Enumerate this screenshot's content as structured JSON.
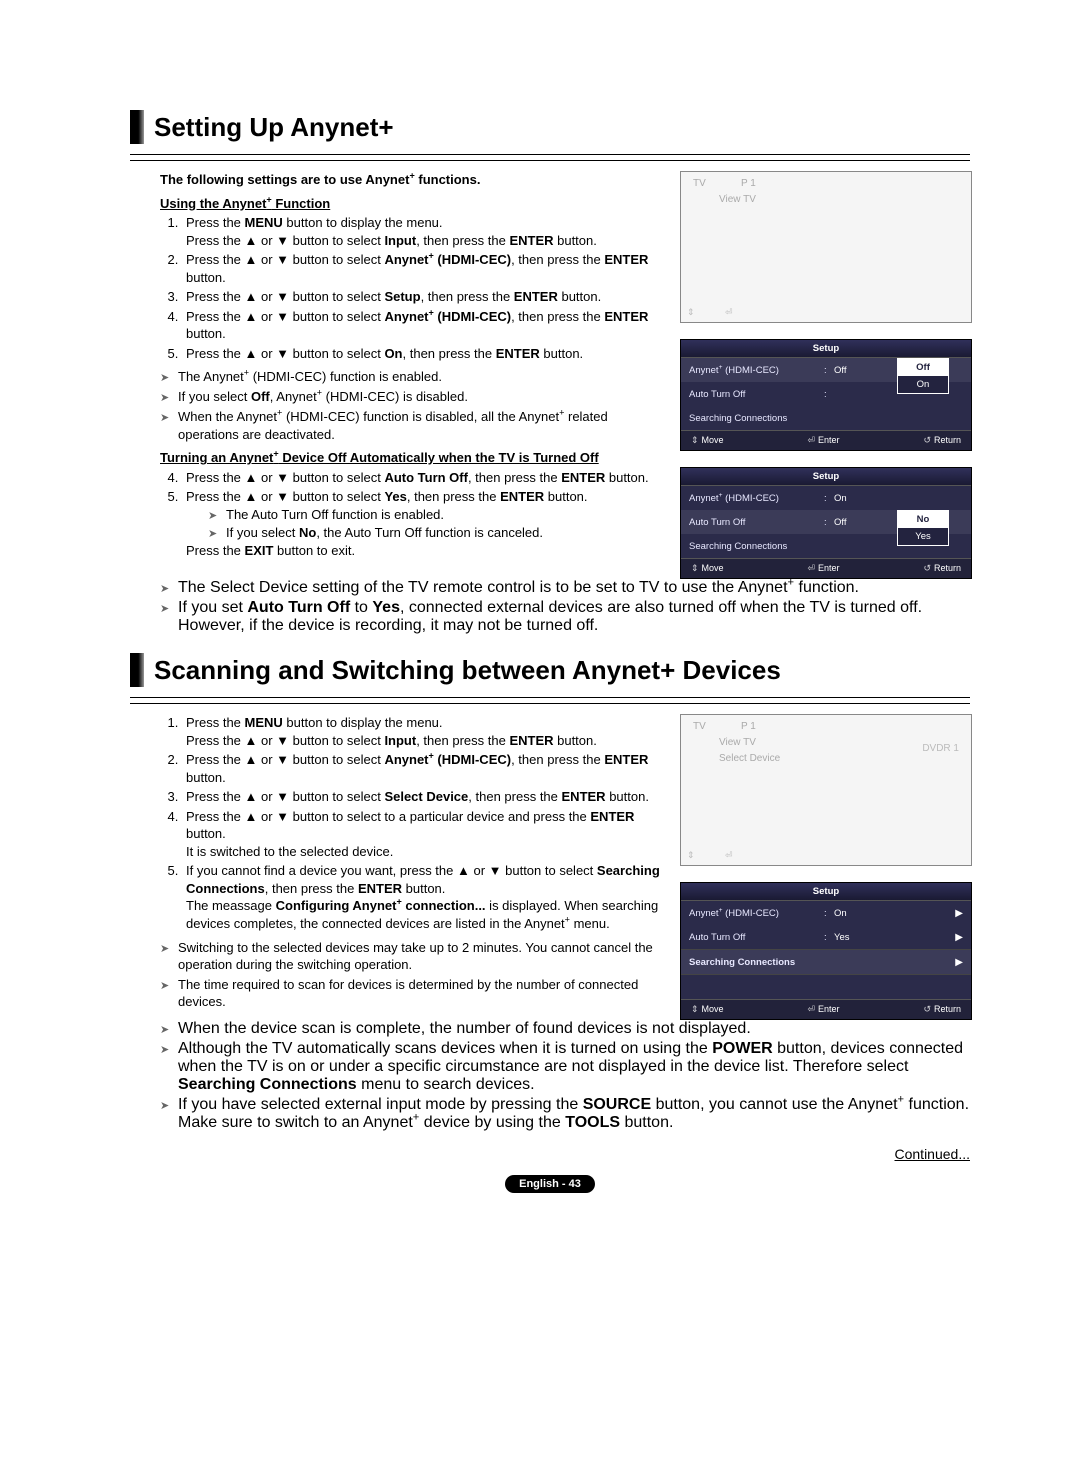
{
  "section1": {
    "title": "Setting Up Anynet+",
    "intro": "The following settings are to use Anynet+ functions.",
    "subhead1": "Using the Anynet+ Function",
    "steps1": [
      "Press the MENU button to display the menu. Press the ▲ or ▼ button to select Input, then press the ENTER button.",
      "Press the ▲ or ▼ button to select Anynet+ (HDMI-CEC), then press the ENTER button.",
      "Press the ▲ or ▼ button to select Setup, then press the ENTER button.",
      "Press the ▲ or ▼ button to select Anynet+ (HDMI-CEC), then press the ENTER button.",
      "Press the ▲ or ▼ button to select On, then press the ENTER button."
    ],
    "notes1": [
      "The Anynet+ (HDMI-CEC) function is enabled.",
      "If you select Off, Anynet+ (HDMI-CEC) is disabled.",
      "When the Anynet+ (HDMI-CEC) function is disabled, all the Anynet+ related operations are deactivated."
    ],
    "subhead2": "Turning an Anynet+ Device Off Automatically when the TV is Turned Off",
    "steps2_start": 4,
    "steps2": [
      "Press the ▲ or ▼ button to select Auto Turn Off, then press the ENTER button.",
      "Press the ▲ or ▼ button to select Yes, then press the ENTER button."
    ],
    "subnotes2": [
      "The Auto Turn Off function is enabled.",
      "If you select No, the Auto Turn Off function is canceled."
    ],
    "exit_line": "Press the EXIT button to exit.",
    "notes2": [
      "The Select Device setting of the TV remote control is to be set to TV to use the Anynet+ function.",
      "If you set Auto Turn Off to Yes, connected external devices are also turned off when the TV is turned off. However, if the device is recording, it may not be turned off."
    ]
  },
  "section2": {
    "title": "Scanning and Switching between Anynet+ Devices",
    "steps": [
      "Press the MENU button to display the menu. Press the ▲ or ▼ button to select Input, then press the ENTER button.",
      "Press the ▲ or ▼ button to select Anynet+ (HDMI-CEC), then press the ENTER button.",
      "Press the ▲ or ▼ button to select Select Device, then press the ENTER button.",
      "Press the ▲ or ▼ button to select to a particular device and press the ENTER button. It is switched to the selected device.",
      "If you cannot find a device you want, press the ▲ or ▼ button to select Searching Connections, then press the ENTER button. The meassage Configuring Anynet+ connection... is displayed. When searching devices completes, the connected devices are listed in the Anynet+ menu."
    ],
    "notes": [
      "Switching to the selected devices may take up to 2 minutes. You cannot cancel the operation during the switching operation.",
      "The time required to scan for devices is determined by the number of connected devices.",
      "When the device scan is complete, the number of found devices is not displayed.",
      "Although the TV automatically scans devices when it is turned on using the POWER button, devices connected when the TV is on or under a specific circumstance are not displayed in the device list. Therefore select Searching Connections menu to search devices.",
      "If you have selected external input mode by pressing the SOURCE button, you cannot use the Anynet+ function. Make sure to switch to an Anynet+ device by using the TOOLS button."
    ]
  },
  "osd": {
    "tv": "TV",
    "p1": "P 1",
    "view_tv": "View TV",
    "select_device": "Select Device",
    "dvdr1": "DVDR 1",
    "setup_header": "Setup",
    "anynet_label": "Anynet+ (HDMI-CEC)",
    "auto_off_label": "Auto Turn Off",
    "searching_label": "Searching Connections",
    "off": "Off",
    "on": "On",
    "no": "No",
    "yes": "Yes",
    "move": "Move",
    "enter": "Enter",
    "return": "Return"
  },
  "continued": "Continued...",
  "page_label": "English - 43"
}
